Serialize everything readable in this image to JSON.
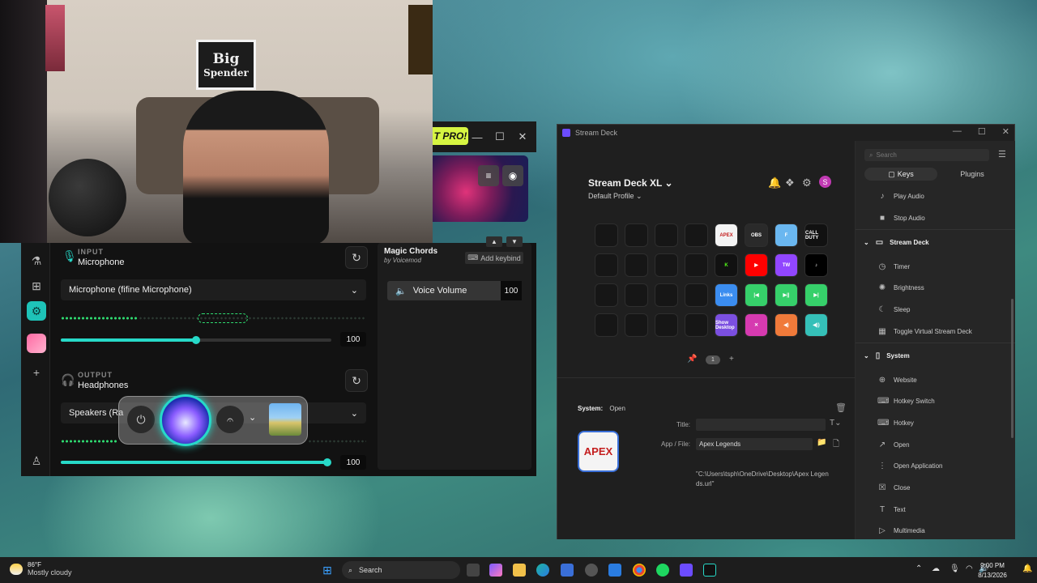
{
  "webcam": {
    "sign_line1": "Big",
    "sign_line2": "Spender"
  },
  "voicemod": {
    "pro_badge": "T PRO!",
    "input": {
      "section_label": "INPUT",
      "name": "Microphone",
      "device": "Microphone (fifine Microphone)",
      "volume": "100",
      "level": 0.42
    },
    "output": {
      "section_label": "OUTPUT",
      "name": "Headphones",
      "device": "Speakers (Ra",
      "volume": "100",
      "level": 1.0
    },
    "voice": {
      "name": "Magic Chords",
      "author": "by Voicemod",
      "keybind_label": "Add keybind",
      "volume_label": "Voice Volume",
      "volume_value": "100"
    },
    "colors": {
      "accent": "#27d9c8",
      "meter": "#2fdc71",
      "pro": "#d6f542"
    }
  },
  "streamdeck": {
    "window_title": "Stream Deck",
    "device": "Stream Deck XL",
    "profile": "Default Profile",
    "avatar_letter": "S",
    "page": "1",
    "keys": [
      {
        "label": "APEX",
        "bg": "#f4f4f4",
        "fg": "#c41e1e"
      },
      {
        "label": "OBS",
        "bg": "#2a2a2a",
        "fg": "#ffffff"
      },
      {
        "label": "F",
        "bg": "#6ab7f0",
        "fg": "#ffffff"
      },
      {
        "label": "CALL DUTY",
        "bg": "#111111",
        "fg": "#ffffff"
      },
      {
        "label": "K",
        "bg": "#111111",
        "fg": "#53fc18"
      },
      {
        "label": "▶",
        "bg": "#ff0000",
        "fg": "#ffffff"
      },
      {
        "label": "TW",
        "bg": "#9146ff",
        "fg": "#ffffff"
      },
      {
        "label": "♪",
        "bg": "#000000",
        "fg": "#ffffff"
      },
      {
        "label": "Links",
        "bg": "#3b8df0",
        "fg": "#ffffff"
      },
      {
        "label": "|◀",
        "bg": "#36d06a",
        "fg": "#ffffff"
      },
      {
        "label": "▶||",
        "bg": "#36d06a",
        "fg": "#ffffff"
      },
      {
        "label": "▶|",
        "bg": "#36d06a",
        "fg": "#ffffff"
      },
      {
        "label": "Show Desktop",
        "bg": "#7b4fe0",
        "fg": "#ffffff"
      },
      {
        "label": "✕",
        "bg": "#d63ab0",
        "fg": "#ffffff"
      },
      {
        "label": "◀)",
        "bg": "#f07a3a",
        "fg": "#ffffff"
      },
      {
        "label": "◀))",
        "bg": "#35c0b8",
        "fg": "#ffffff"
      }
    ],
    "properties": {
      "system_label": "System:",
      "action": "Open",
      "title_label": "Title:",
      "title_value": "",
      "app_label": "App / File:",
      "app_value": "Apex Legends",
      "path_line1": "\"C:\\Users\\tsph\\OneDrive\\Desktop\\Apex Legen",
      "path_line2": "ds.url\"",
      "icon_label": "APEX"
    },
    "sidebar": {
      "search_placeholder": "Search",
      "tab_keys": "Keys",
      "tab_plugins": "Plugins",
      "items_top": [
        {
          "label": "Play Audio",
          "icon": "♪"
        },
        {
          "label": "Stop Audio",
          "icon": "■"
        }
      ],
      "cat_streamdeck": "Stream Deck",
      "items_sd": [
        {
          "label": "Timer",
          "icon": "◷"
        },
        {
          "label": "Brightness",
          "icon": "✺"
        },
        {
          "label": "Sleep",
          "icon": "☾"
        },
        {
          "label": "Toggle Virtual Stream Deck",
          "icon": "▦"
        }
      ],
      "cat_system": "System",
      "items_sys": [
        {
          "label": "Website",
          "icon": "⊕"
        },
        {
          "label": "Hotkey Switch",
          "icon": "⌨"
        },
        {
          "label": "Hotkey",
          "icon": "⌨"
        },
        {
          "label": "Open",
          "icon": "↗"
        },
        {
          "label": "Open Application",
          "icon": "⋮"
        },
        {
          "label": "Close",
          "icon": "☒"
        },
        {
          "label": "Text",
          "icon": "T"
        },
        {
          "label": "Multimedia",
          "icon": "▷"
        }
      ]
    }
  },
  "taskbar": {
    "temp": "86°F",
    "weather": "Mostly cloudy",
    "search": "Search",
    "time": "9:00 PM",
    "date": "8/13/2026"
  }
}
